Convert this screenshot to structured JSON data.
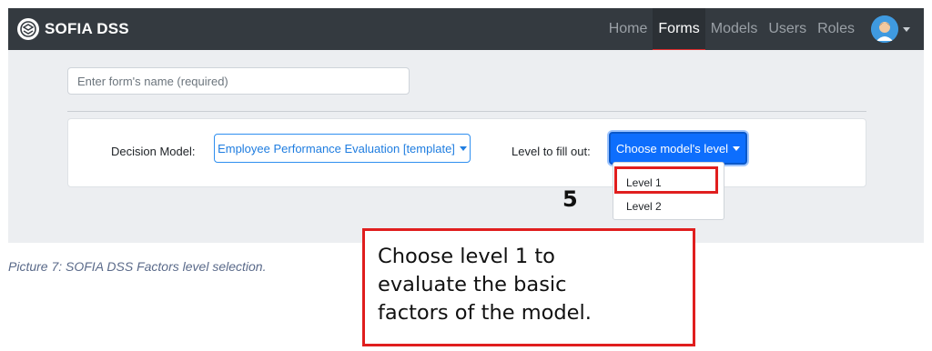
{
  "app": {
    "brand": "SOFIA DSS"
  },
  "nav": {
    "items": [
      {
        "label": "Home",
        "active": false
      },
      {
        "label": "Forms",
        "active": true
      },
      {
        "label": "Models",
        "active": false
      },
      {
        "label": "Users",
        "active": false
      },
      {
        "label": "Roles",
        "active": false
      }
    ],
    "avatar_icon": "user-avatar-icon",
    "avatar_caret_icon": "caret-down-icon"
  },
  "form": {
    "name_placeholder": "Enter form's name (required)",
    "name_value": "",
    "decision_model_label": "Decision Model:",
    "decision_model_value": "Employee Performance Evaluation [template]",
    "level_label": "Level to fill out:",
    "level_button": "Choose model's level",
    "level_options": [
      "Level 1",
      "Level 2"
    ]
  },
  "annotation": {
    "step_number": "5",
    "callout_text": "Choose level 1 to\nevaluate the basic\nfactors of the model.",
    "highlight_color": "#e01e1e"
  },
  "caption": "Picture 7: SOFIA DSS Factors level selection.",
  "colors": {
    "navbar_bg": "#343a40",
    "primary": "#0d6efd",
    "active_underline": "#d92b2b"
  }
}
